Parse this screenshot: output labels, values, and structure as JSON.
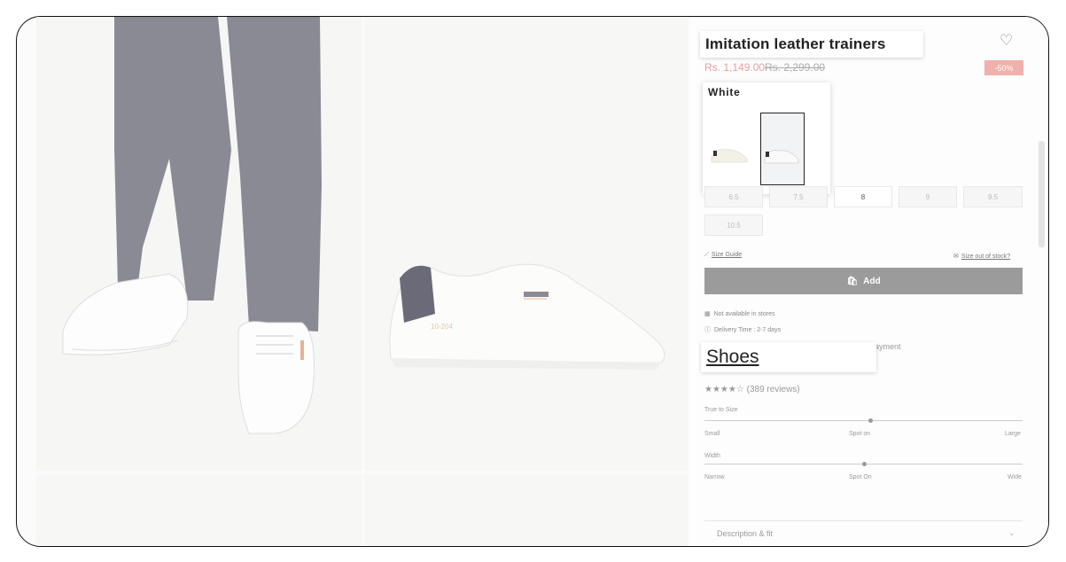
{
  "product": {
    "title": "Imitation leather trainers",
    "price_now": "Rs. 1,149.00",
    "price_old": "Rs. 2,299.00",
    "discount": "-50%",
    "color_name": "White",
    "image_text": "10-204"
  },
  "sizes": [
    "6.5",
    "7.5",
    "8",
    "9",
    "9.5",
    "10.5"
  ],
  "links": {
    "size_guide": "Size Guide",
    "size_out_of_stock": "Size out of stock?"
  },
  "add_button": "Add",
  "availability": {
    "stores": "Not available in stores",
    "delivery": "Delivery Time : 2-7 days",
    "payment": "ayment"
  },
  "category": "Shoes",
  "reviews": {
    "stars": "★★★★☆",
    "count": "(389 reviews)"
  },
  "fit": {
    "true_to_size": {
      "label": "True to Size",
      "low": "Small",
      "mid": "Spot on",
      "high": "Large",
      "level": 0.52
    },
    "width": {
      "label": "Width",
      "low": "Narrow",
      "mid": "Spot On",
      "high": "Wide",
      "level": 0.5
    }
  },
  "description_label": "Description & fit",
  "icons": [
    "heart-icon",
    "ruler-icon",
    "mail-icon",
    "bag-icon",
    "store-icon",
    "info-icon",
    "chevron-down-icon"
  ]
}
